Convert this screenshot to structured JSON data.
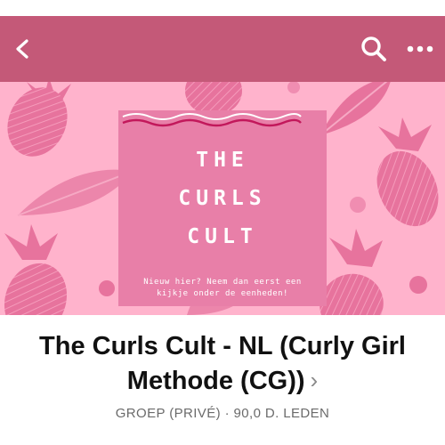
{
  "header": {
    "back_icon": "chevron-left-icon",
    "search_icon": "search-icon",
    "more_icon": "more-horizontal-icon",
    "color": "#c45978"
  },
  "cover": {
    "background_color": "#ffb3cc",
    "accent_color": "#e87fa8",
    "title_lines": [
      "THE",
      "CURLS",
      "CULT"
    ],
    "subtitle_line1": "Nieuw hier? Neem dan eerst een",
    "subtitle_line2": "kijkje onder de eenheden!"
  },
  "group": {
    "name": "The Curls Cult - NL (Curly Girl Methode (CG))",
    "chevron": "›",
    "meta": "GROEP (PRIVÉ) · 90,0 D. LEDEN"
  }
}
